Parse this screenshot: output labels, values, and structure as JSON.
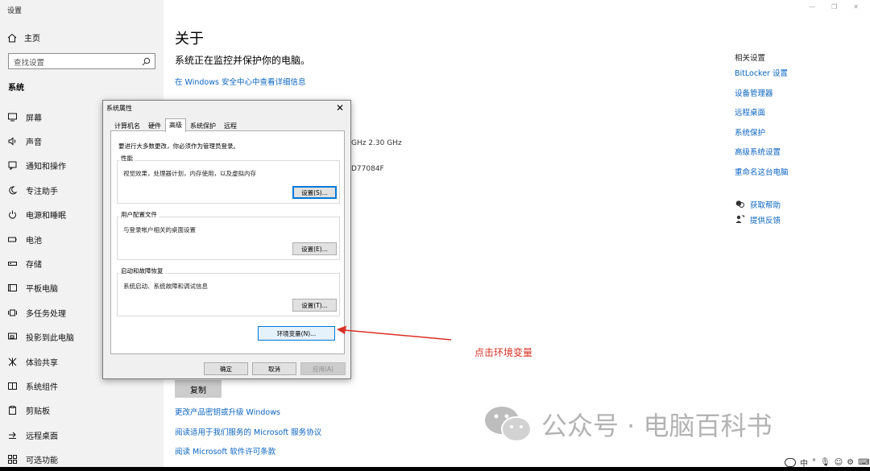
{
  "app": {
    "title": "设置"
  },
  "sidebar": {
    "home_label": "主页",
    "search_placeholder": "查找设置",
    "section_title": "系统",
    "items": [
      {
        "label": "屏幕",
        "icon": "display-icon"
      },
      {
        "label": "声音",
        "icon": "speaker-icon"
      },
      {
        "label": "通知和操作",
        "icon": "notification-icon"
      },
      {
        "label": "专注助手",
        "icon": "moon-icon"
      },
      {
        "label": "电源和睡眠",
        "icon": "power-icon"
      },
      {
        "label": "电池",
        "icon": "battery-icon"
      },
      {
        "label": "存储",
        "icon": "storage-icon"
      },
      {
        "label": "平板电脑",
        "icon": "tablet-icon"
      },
      {
        "label": "多任务处理",
        "icon": "multitask-icon"
      },
      {
        "label": "投影到此电脑",
        "icon": "project-icon"
      },
      {
        "label": "体验共享",
        "icon": "share-icon"
      },
      {
        "label": "系统组件",
        "icon": "components-icon"
      },
      {
        "label": "剪贴板",
        "icon": "clipboard-icon"
      },
      {
        "label": "远程桌面",
        "icon": "remote-icon"
      },
      {
        "label": "可选功能",
        "icon": "optional-icon"
      }
    ]
  },
  "main": {
    "title": "关于",
    "protect_text": "系统正在监控并保护你的电脑。",
    "security_link": "在 Windows 安全中心中查看详细信息",
    "spec_partial_1": "GHz   2.30 GHz",
    "spec_partial_2": "D77084F",
    "spec_partial_3": "",
    "copy_button": "复制",
    "bottom_links": [
      "更改产品密钥或升级 Windows",
      "阅读适用于我们服务的 Microsoft 服务协议",
      "阅读 Microsoft 软件许可条款"
    ]
  },
  "related": {
    "title": "相关设置",
    "links": [
      "BitLocker 设置",
      "设备管理器",
      "远程桌面",
      "系统保护",
      "高级系统设置",
      "重命名这台电脑"
    ],
    "help": "获取帮助",
    "feedback": "提供反馈"
  },
  "dialog": {
    "title": "系统属性",
    "close": "✕",
    "tabs": [
      "计算机名",
      "硬件",
      "高级",
      "系统保护",
      "远程"
    ],
    "active_tab": "高级",
    "admin_note": "要进行大多数更改，你必须作为管理员登录。",
    "performance": {
      "label": "性能",
      "desc": "视觉效果，处理器计划，内存使用，以及虚拟内存",
      "button": "设置(S)..."
    },
    "profile": {
      "label": "用户配置文件",
      "desc": "与登录帐户相关的桌面设置",
      "button": "设置(E)..."
    },
    "startup": {
      "label": "启动和故障恢复",
      "desc": "系统启动、系统故障和调试信息",
      "button": "设置(T)..."
    },
    "env_button": "环境变量(N)...",
    "ok": "确定",
    "cancel": "取消",
    "apply": "应用(A)"
  },
  "annotation": {
    "text": "点击环境变量",
    "color": "#d93025"
  },
  "watermark": {
    "text": "公众号 · 电脑百科书"
  },
  "tray": {
    "ime": "中"
  },
  "colors": {
    "link": "#0a64c2",
    "sidebar_bg": "#f2f2f2",
    "dialog_bg": "#f0f0f0",
    "focus": "#0078d7"
  }
}
